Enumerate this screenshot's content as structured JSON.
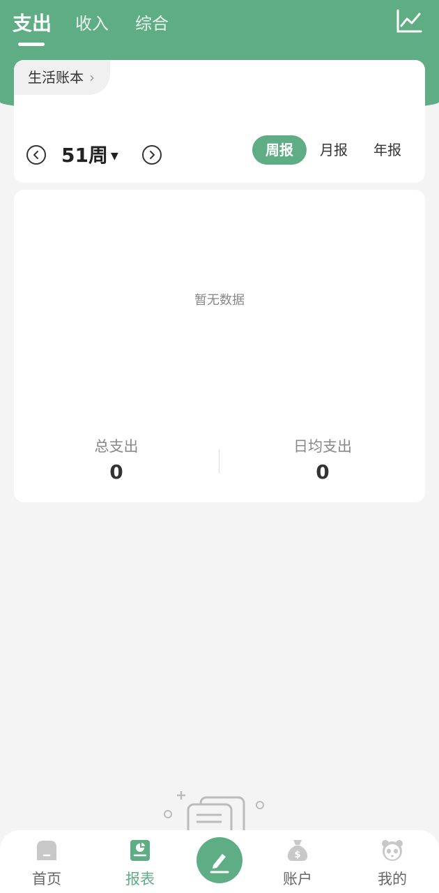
{
  "top_tabs": [
    "支出",
    "收入",
    "综合"
  ],
  "book": {
    "name": "生活账本",
    "chevron": "›"
  },
  "period": {
    "label": "51周",
    "caret": "▼"
  },
  "segments": [
    "周报",
    "月报",
    "年报"
  ],
  "empty_text": "暂无数据",
  "stats": [
    {
      "label": "总支出",
      "value": "0"
    },
    {
      "label": "日均支出",
      "value": "0"
    }
  ],
  "bottom_nav": [
    "首页",
    "报表",
    "账户",
    "我的"
  ],
  "colors": {
    "accent": "#5fad85",
    "background": "#f4f4f4"
  }
}
